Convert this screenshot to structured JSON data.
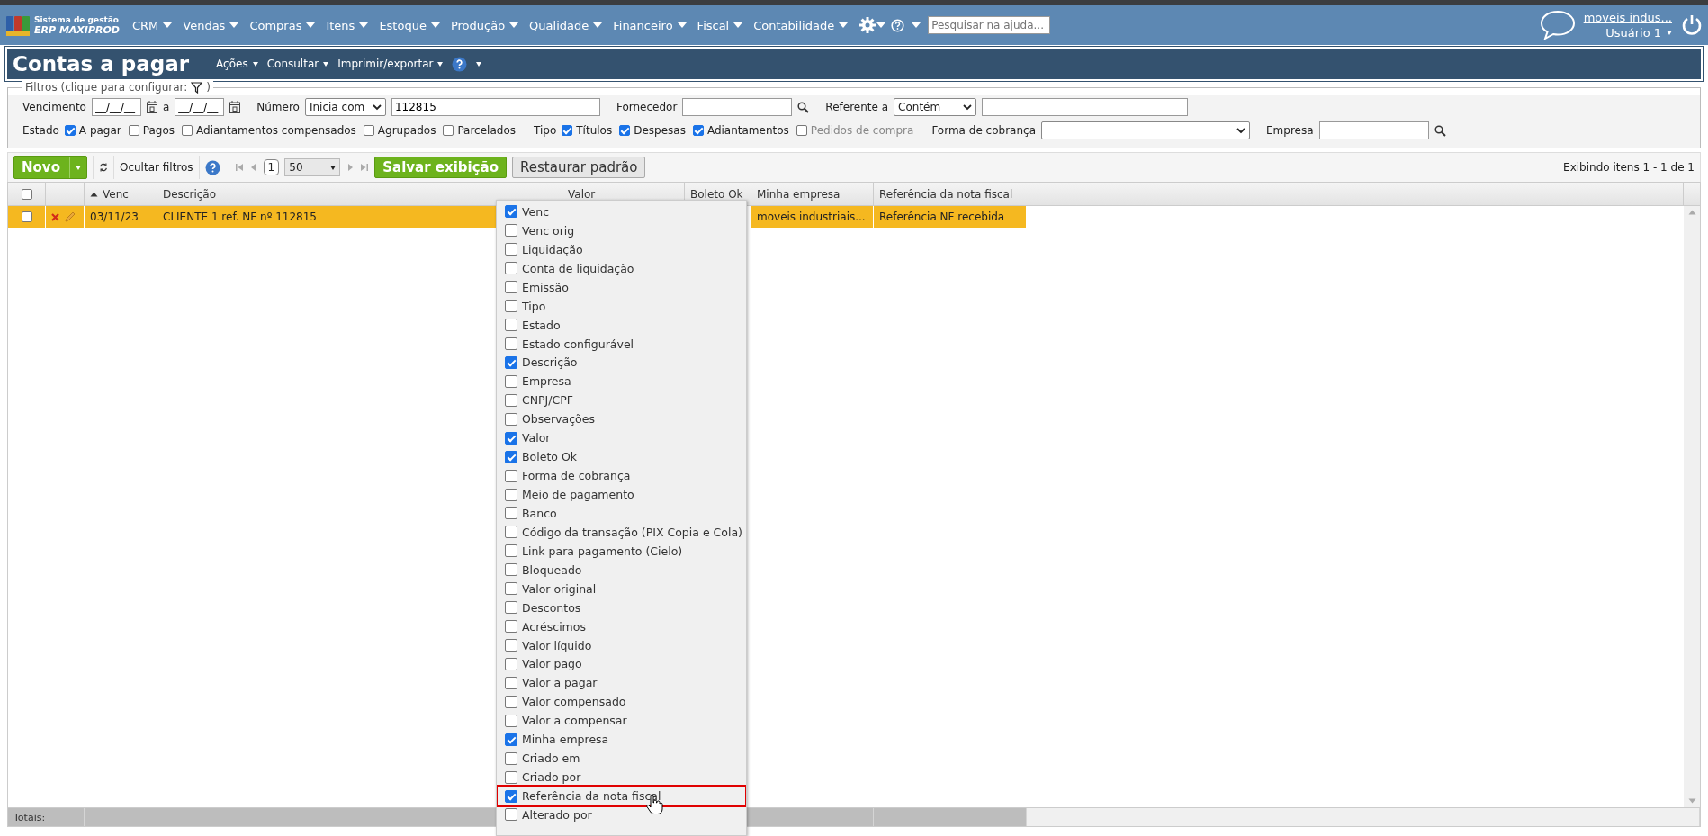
{
  "top_nav": {
    "logo_line1": "Sistema de gestão",
    "logo_line2": "ERP MAXIPROD",
    "menus": [
      "CRM",
      "Vendas",
      "Compras",
      "Itens",
      "Estoque",
      "Produção",
      "Qualidade",
      "Financeiro",
      "Fiscal",
      "Contabilidade"
    ],
    "help_search": {
      "placeholder": "Pesquisar na ajuda..."
    },
    "company_link": "moveis indus...",
    "user": "Usuário 1"
  },
  "page_header": {
    "title": "Contas a pagar",
    "menus": [
      "Ações",
      "Consultar",
      "Imprimir/exportar"
    ]
  },
  "filters": {
    "legend": "Filtros (clique para configurar:",
    "legend_close": ")",
    "vencimento": {
      "label": "Vencimento",
      "from": "__/__/__",
      "separator": "a",
      "to": "__/__/__"
    },
    "numero": {
      "label": "Número",
      "operator": "Inicia com",
      "value": "112815"
    },
    "fornecedor": {
      "label": "Fornecedor"
    },
    "referente": {
      "label": "Referente a",
      "operator": "Contém"
    },
    "estado": {
      "label": "Estado",
      "options": [
        {
          "label": "A pagar",
          "checked": true,
          "disabled": false
        },
        {
          "label": "Pagos",
          "checked": false,
          "disabled": false
        },
        {
          "label": "Adiantamentos compensados",
          "checked": false,
          "disabled": false
        },
        {
          "label": "Agrupados",
          "checked": false,
          "disabled": false
        },
        {
          "label": "Parcelados",
          "checked": false,
          "disabled": false
        }
      ]
    },
    "tipo": {
      "label": "Tipo",
      "options": [
        {
          "label": "Títulos",
          "checked": true,
          "disabled": false
        },
        {
          "label": "Despesas",
          "checked": true,
          "disabled": false
        },
        {
          "label": "Adiantamentos",
          "checked": true,
          "disabled": false
        },
        {
          "label": "Pedidos de compra",
          "checked": false,
          "disabled": true
        }
      ]
    },
    "forma_cobranca": {
      "label": "Forma de cobrança"
    },
    "empresa": {
      "label": "Empresa"
    }
  },
  "toolbar": {
    "new_button": "Novo",
    "hide_filters": "Ocultar filtros",
    "page": "1",
    "per_page": "50",
    "save_view": "Salvar exibição",
    "restore_default": "Restaurar padrão",
    "item_count": "Exibindo itens 1 - 1 de 1"
  },
  "table": {
    "select_all_checked": false,
    "columns": [
      {
        "label": "Venc",
        "sorted": true
      },
      {
        "label": "Descrição",
        "sorted": false
      },
      {
        "label": "Valor",
        "sorted": false
      },
      {
        "label": "Boleto Ok",
        "sorted": false
      },
      {
        "label": "Minha empresa",
        "sorted": false
      },
      {
        "label": "Referência da nota fiscal",
        "sorted": false
      }
    ],
    "rows": [
      {
        "selected": true,
        "checked": false,
        "venc": "03/11/23",
        "descricao": "CLIENTE 1 ref. NF nº 112815",
        "minha_empresa": "moveis industriais...",
        "referencia": "Referência NF recebida"
      }
    ],
    "totals_label": "Totais:"
  },
  "column_menu": {
    "items": [
      {
        "label": "Venc",
        "checked": true,
        "highlighted": false
      },
      {
        "label": "Venc orig",
        "checked": false,
        "highlighted": false
      },
      {
        "label": "Liquidação",
        "checked": false,
        "highlighted": false
      },
      {
        "label": "Conta de liquidação",
        "checked": false,
        "highlighted": false
      },
      {
        "label": "Emissão",
        "checked": false,
        "highlighted": false
      },
      {
        "label": "Tipo",
        "checked": false,
        "highlighted": false
      },
      {
        "label": "Estado",
        "checked": false,
        "highlighted": false
      },
      {
        "label": "Estado configurável",
        "checked": false,
        "highlighted": false
      },
      {
        "label": "Descrição",
        "checked": true,
        "highlighted": false
      },
      {
        "label": "Empresa",
        "checked": false,
        "highlighted": false
      },
      {
        "label": "CNPJ/CPF",
        "checked": false,
        "highlighted": false
      },
      {
        "label": "Observações",
        "checked": false,
        "highlighted": false
      },
      {
        "label": "Valor",
        "checked": true,
        "highlighted": false
      },
      {
        "label": "Boleto Ok",
        "checked": true,
        "highlighted": false
      },
      {
        "label": "Forma de cobrança",
        "checked": false,
        "highlighted": false
      },
      {
        "label": "Meio de pagamento",
        "checked": false,
        "highlighted": false
      },
      {
        "label": "Banco",
        "checked": false,
        "highlighted": false
      },
      {
        "label": "Código da transação (PIX Copia e Cola)",
        "checked": false,
        "highlighted": false
      },
      {
        "label": "Link para pagamento (Cielo)",
        "checked": false,
        "highlighted": false
      },
      {
        "label": "Bloqueado",
        "checked": false,
        "highlighted": false
      },
      {
        "label": "Valor original",
        "checked": false,
        "highlighted": false
      },
      {
        "label": "Descontos",
        "checked": false,
        "highlighted": false
      },
      {
        "label": "Acréscimos",
        "checked": false,
        "highlighted": false
      },
      {
        "label": "Valor líquido",
        "checked": false,
        "highlighted": false
      },
      {
        "label": "Valor pago",
        "checked": false,
        "highlighted": false
      },
      {
        "label": "Valor a pagar",
        "checked": false,
        "highlighted": false
      },
      {
        "label": "Valor compensado",
        "checked": false,
        "highlighted": false
      },
      {
        "label": "Valor a compensar",
        "checked": false,
        "highlighted": false
      },
      {
        "label": "Minha empresa",
        "checked": true,
        "highlighted": false
      },
      {
        "label": "Criado em",
        "checked": false,
        "highlighted": false
      },
      {
        "label": "Criado por",
        "checked": false,
        "highlighted": false
      },
      {
        "label": "Referência da nota fiscal",
        "checked": true,
        "highlighted": true
      },
      {
        "label": "Alterado por",
        "checked": false,
        "highlighted": false
      }
    ]
  }
}
